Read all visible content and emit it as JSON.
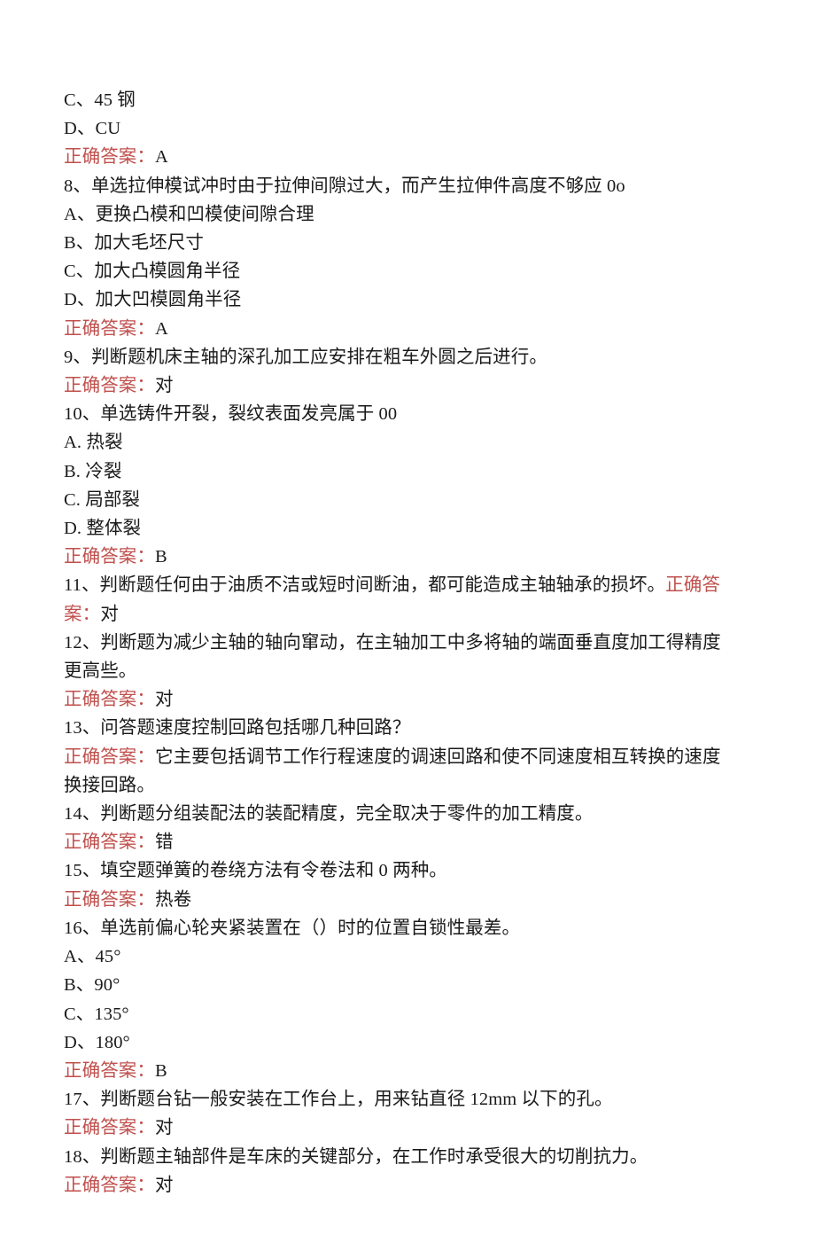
{
  "document": {
    "type": "exam-question-bank",
    "language": "zh-CN",
    "answer_label": "正确答案：",
    "answer_label_color": "#c0504d",
    "body_text_color": "#1a1a1a",
    "background_color": "#ffffff"
  },
  "lines": [
    {
      "kind": "option",
      "text": "C、45 钢"
    },
    {
      "kind": "option",
      "text": "D、CU"
    },
    {
      "kind": "answer",
      "label": "正确答案：",
      "value": "A"
    },
    {
      "kind": "question",
      "text": "8、单选拉伸模试冲时由于拉伸间隙过大，而产生拉伸件高度不够应 0o"
    },
    {
      "kind": "option",
      "text": "A、更换凸模和凹模使间隙合理"
    },
    {
      "kind": "option",
      "text": "B、加大毛坯尺寸"
    },
    {
      "kind": "option",
      "text": "C、加大凸模圆角半径"
    },
    {
      "kind": "option",
      "text": "D、加大凹模圆角半径"
    },
    {
      "kind": "answer",
      "label": "正确答案：",
      "value": "A"
    },
    {
      "kind": "question",
      "text": "9、判断题机床主轴的深孔加工应安排在粗车外圆之后进行。"
    },
    {
      "kind": "answer",
      "label": "正确答案：",
      "value": "对"
    },
    {
      "kind": "question",
      "text": "10、单选铸件开裂，裂纹表面发亮属于 00"
    },
    {
      "kind": "option",
      "text": "A. 热裂"
    },
    {
      "kind": "option",
      "text": "B. 冷裂"
    },
    {
      "kind": "option",
      "text": "C. 局部裂"
    },
    {
      "kind": "option",
      "text": "D. 整体裂"
    },
    {
      "kind": "answer",
      "label": "正确答案：",
      "value": "B"
    },
    {
      "kind": "question-with-inline-answer",
      "text": "11、判断题任何由于油质不洁或短时间断油，都可能造成主轴轴承的损坏。",
      "label": "正确答案：",
      "value": "对"
    },
    {
      "kind": "question",
      "text": "12、判断题为减少主轴的轴向窜动，在主轴加工中多将轴的端面垂直度加工得精度更高些。"
    },
    {
      "kind": "answer",
      "label": "正确答案：",
      "value": "对"
    },
    {
      "kind": "question",
      "text": "13、问答题速度控制回路包括哪几种回路？"
    },
    {
      "kind": "answer",
      "label": "正确答案：",
      "value": "它主要包括调节工作行程速度的调速回路和使不同速度相互转换的速度换接回路。"
    },
    {
      "kind": "question",
      "text": "14、判断题分组装配法的装配精度，完全取决于零件的加工精度。"
    },
    {
      "kind": "answer",
      "label": "正确答案：",
      "value": "错"
    },
    {
      "kind": "question",
      "text": "15、填空题弹簧的卷绕方法有令卷法和 0 两种。"
    },
    {
      "kind": "answer",
      "label": "正确答案：",
      "value": "热卷"
    },
    {
      "kind": "question",
      "text": "16、单选前偏心轮夹紧装置在（）时的位置自锁性最差。"
    },
    {
      "kind": "option",
      "text": "A、45°"
    },
    {
      "kind": "option",
      "text": "B、90°"
    },
    {
      "kind": "option",
      "text": "C、135°"
    },
    {
      "kind": "option",
      "text": "D、180°"
    },
    {
      "kind": "answer",
      "label": "正确答案：",
      "value": "B"
    },
    {
      "kind": "question",
      "text": "17、判断题台钻一般安装在工作台上，用来钻直径 12mm 以下的孔。"
    },
    {
      "kind": "answer",
      "label": "正确答案：",
      "value": "对"
    },
    {
      "kind": "question",
      "text": "18、判断题主轴部件是车床的关键部分，在工作时承受很大的切削抗力。"
    },
    {
      "kind": "answer",
      "label": "正确答案：",
      "value": "对"
    }
  ]
}
